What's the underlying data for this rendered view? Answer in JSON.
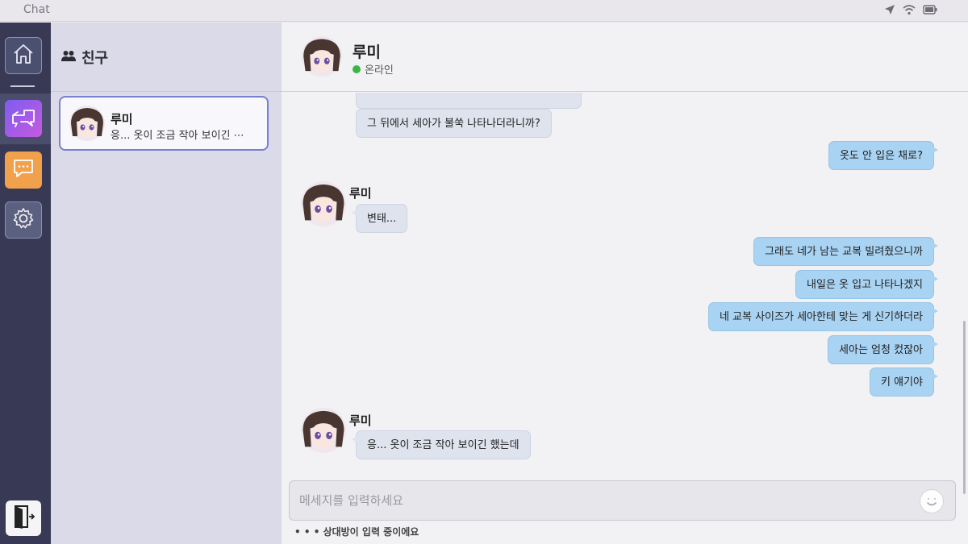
{
  "app": {
    "title": "Chat"
  },
  "nav": {
    "items": [
      {
        "id": "home",
        "icon": "home-icon"
      },
      {
        "id": "chats",
        "icon": "chat-swap-icon"
      },
      {
        "id": "talk",
        "icon": "speech-bubble-icon"
      },
      {
        "id": "settings",
        "icon": "gear-icon"
      },
      {
        "id": "exit",
        "icon": "exit-door-icon"
      }
    ]
  },
  "friends": {
    "title": "친구",
    "items": [
      {
        "name": "루미",
        "preview": "응... 옷이 조금 작아 보이긴 ⋯"
      }
    ]
  },
  "chat": {
    "contact": {
      "name": "루미",
      "status": "온라인"
    },
    "messages": [
      {
        "from": "them",
        "text": "그 뒤에서 세아가 불쑥 나타나더라니까?"
      },
      {
        "from": "me",
        "text": "옷도 안 입은 채로?"
      },
      {
        "from": "them",
        "name": "루미",
        "text": "변태..."
      },
      {
        "from": "me",
        "text": "그래도 네가 남는 교복 빌려줬으니까"
      },
      {
        "from": "me",
        "text": "내일은 옷 입고 나타나겠지"
      },
      {
        "from": "me",
        "text": "네 교복 사이즈가 세아한테 맞는 게 신기하더라"
      },
      {
        "from": "me",
        "text": "세아는 엄청 컸잖아"
      },
      {
        "from": "me",
        "text": "키 얘기야"
      },
      {
        "from": "them",
        "name": "루미",
        "text": "응... 옷이 조금 작아 보이긴 했는데"
      }
    ],
    "composer": {
      "placeholder": "메세지를 입력하세요"
    },
    "typing_indicator": "상대방이 입력 중이에요"
  },
  "colors": {
    "rail": "#383a55",
    "bubble_in": "#dfe3ee",
    "bubble_out": "#a9d3f2",
    "online": "#3bb54a",
    "accent": "#7b7fd1"
  }
}
